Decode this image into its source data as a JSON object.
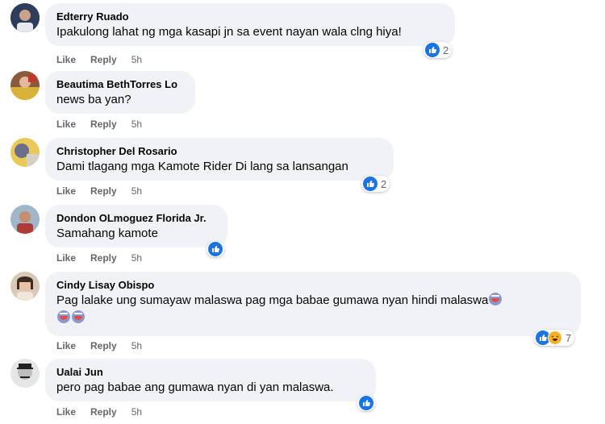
{
  "labels": {
    "like": "Like",
    "reply": "Reply"
  },
  "colors": {
    "like_blue": "#1b74e4",
    "haha_yellow": "#f7b125",
    "bubble_bg": "#f0f2f5",
    "meta_text": "#65676b"
  },
  "comments": [
    {
      "author": "Edterry Ruado",
      "text": "Ipakulong lahat ng mga kasapi jn sa event nayan wala clng hiya!",
      "time": "5h",
      "reaction_count": "2",
      "reactions": [
        "like"
      ]
    },
    {
      "author": "Beautima BethTorres Lo",
      "text": "news ba yan?",
      "time": "5h"
    },
    {
      "author": "Christopher Del Rosario",
      "text": "Dami tlagang mga Kamote Rider Di lang sa lansangan",
      "time": "5h",
      "reaction_count": "2",
      "reactions": [
        "like"
      ]
    },
    {
      "author": "Dondon OLmoguez Florida Jr.",
      "text": "Samahang kamote",
      "time": "5h",
      "reactions": [
        "like"
      ]
    },
    {
      "author": "Cindy Lisay Obispo",
      "text": "Pag lalake ung sumayaw malaswa pag mga babae gumawa nyan hindi malaswa",
      "time": "5h",
      "reaction_count": "7",
      "reactions": [
        "like",
        "haha"
      ],
      "emoji": "clown-face"
    },
    {
      "author": "Ualai Jun",
      "text": "pero pag babae ang gumawa nyan di yan malaswa.",
      "time": "5h",
      "reactions": [
        "like"
      ]
    }
  ]
}
